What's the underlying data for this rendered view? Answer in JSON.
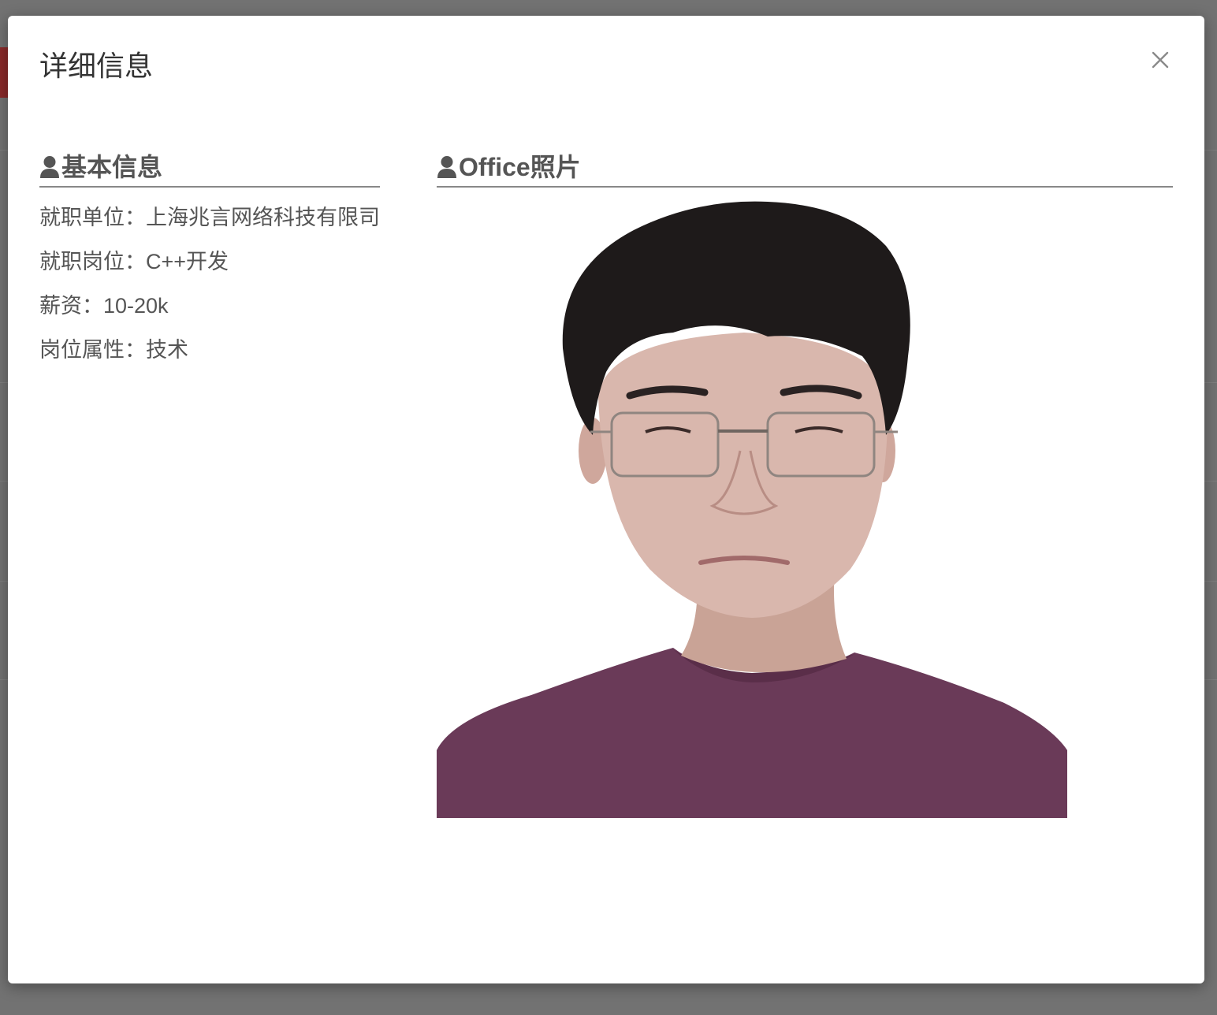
{
  "modal": {
    "title": "详细信息",
    "close_icon": "close-icon"
  },
  "basic_info": {
    "header_icon": "user-icon",
    "header_label": "基本信息",
    "items": [
      {
        "label": "就职单位：",
        "value": "上海兆言网络科技有限司"
      },
      {
        "label": "就职岗位：",
        "value": "C++开发"
      },
      {
        "label": "薪资：",
        "value": "10-20k"
      },
      {
        "label": "岗位属性：",
        "value": "技术"
      }
    ]
  },
  "photo_section": {
    "header_icon": "user-icon",
    "header_label": "Office照片",
    "photo_colors": {
      "shirt": "#6a3a58",
      "skin": "#d9b7ad",
      "hair": "#1e1a1a"
    }
  },
  "colors": {
    "overlay": "#6d6d6d",
    "modal_bg": "#ffffff",
    "text": "#555555",
    "title": "#333333"
  }
}
